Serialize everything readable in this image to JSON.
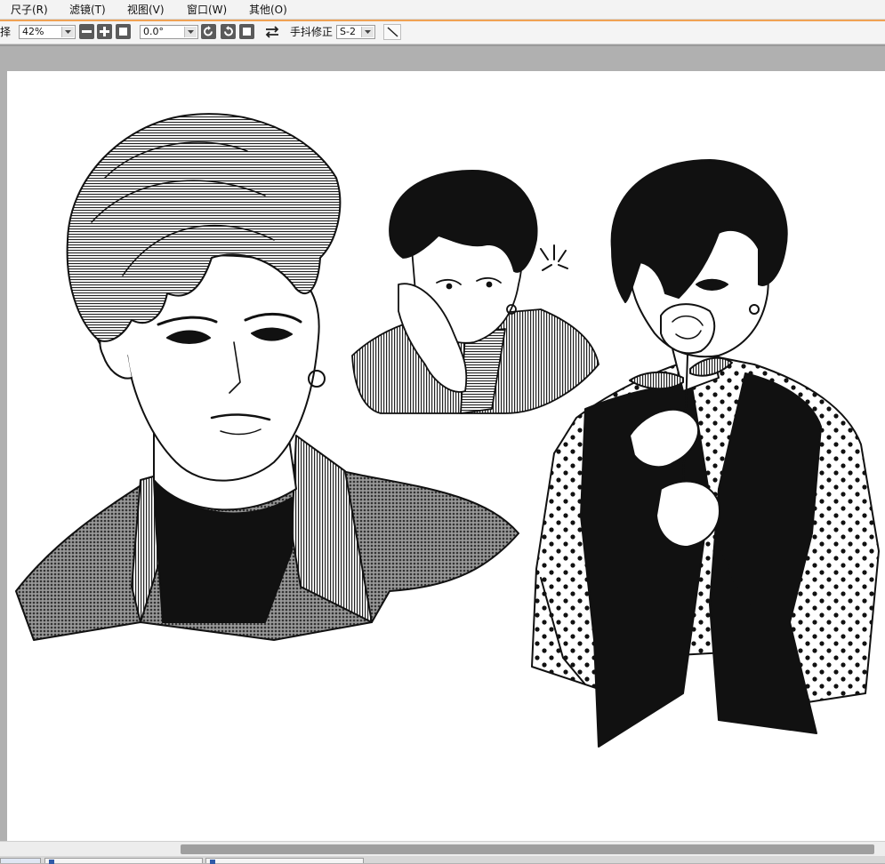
{
  "menubar": {
    "items": [
      "尺子(R)",
      "滤镜(T)",
      "视图(V)",
      "窗口(W)",
      "其他(O)"
    ]
  },
  "toolbar": {
    "select_label": "择",
    "zoom_value": "42%",
    "angle_value": "0.0°",
    "stabilizer_label": "手抖修正",
    "stabilizer_value": "S-2"
  },
  "colors": {
    "menubar_bg": "#f3f3f3",
    "accent_line": "#f0a254",
    "canvas_bg": "#b0b0b0",
    "paper": "#ffffff",
    "tab_mark": "#2f5aa8"
  },
  "scrollbar": {
    "horizontal_thumb_start": 0.204,
    "horizontal_thumb_extent": 0.784
  }
}
